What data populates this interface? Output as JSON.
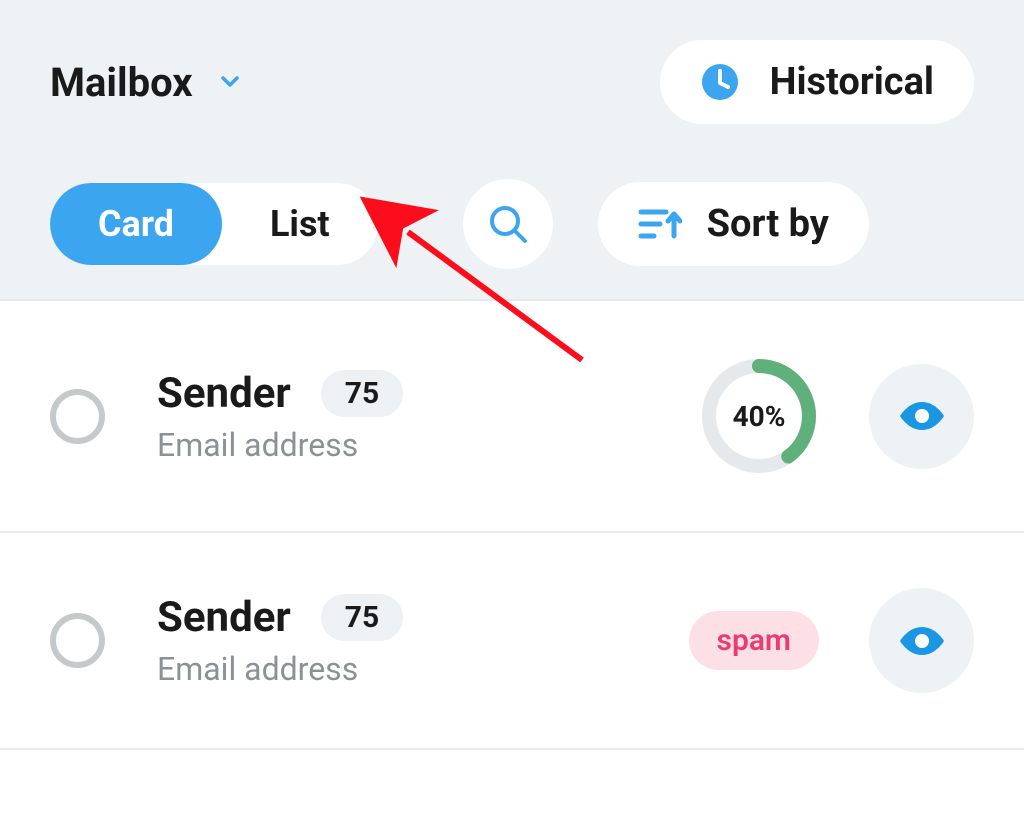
{
  "header": {
    "mailbox_label": "Mailbox",
    "historical_label": "Historical"
  },
  "toolbar": {
    "card_label": "Card",
    "list_label": "List",
    "sort_label": "Sort by"
  },
  "list": [
    {
      "sender": "Sender",
      "count": "75",
      "email": "Email address",
      "progress_text": "40%",
      "progress_value": 40,
      "badge": null
    },
    {
      "sender": "Sender",
      "count": "75",
      "email": "Email address",
      "progress_text": null,
      "progress_value": null,
      "badge": "spam"
    }
  ],
  "colors": {
    "accent": "#3ba6ef",
    "ring_track": "#e6e9eb",
    "ring_fill": "#5fb07a",
    "spam_bg": "#fde0e6",
    "spam_fg": "#ea3b72",
    "arrow": "#fc0d1b"
  }
}
